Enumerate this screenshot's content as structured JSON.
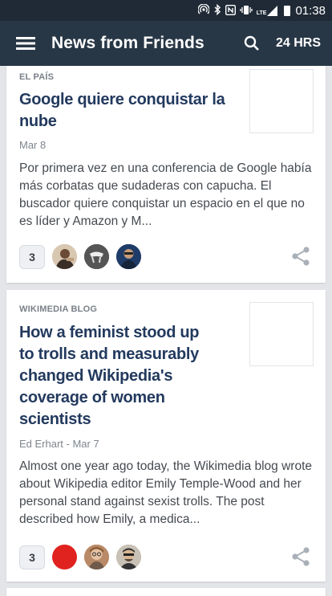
{
  "status_bar": {
    "time": "01:38",
    "icons": [
      "hotspot-icon",
      "bluetooth-icon",
      "nfc-icon",
      "vibrate-icon",
      "lte-signal-icon",
      "battery-icon"
    ],
    "lte_label": "LTE"
  },
  "app_bar": {
    "title": "News from Friends",
    "period": "24 HRS",
    "menu_icon": "hamburger-menu-icon",
    "search_icon": "search-icon"
  },
  "articles": [
    {
      "source": "EL PAÍS",
      "headline": "Google quiere conquistar la nube",
      "meta": "Mar 8",
      "excerpt": "Por primera vez en una conferencia de Google había más corbatas que sudaderas con capucha. El buscador quiere conquistar un espacio en el que no es líder y Amazon y M...",
      "friend_count": "3"
    },
    {
      "source": "WIKIMEDIA BLOG",
      "headline": "How a feminist stood up to trolls and measurably changed Wikipedia's coverage of women scientists",
      "meta": "Ed Erhart - Mar 7",
      "excerpt": "Almost one year ago today, the Wikimedia blog wrote about Wikipedia editor Emily Temple-Wood and her personal stand against sexist trolls. The post described how Emily, a medica...",
      "friend_count": "3"
    }
  ],
  "colors": {
    "status_bar": "#1f2a36",
    "app_bar": "#283746",
    "headline": "#233a5e",
    "background": "#e3e5e8"
  }
}
